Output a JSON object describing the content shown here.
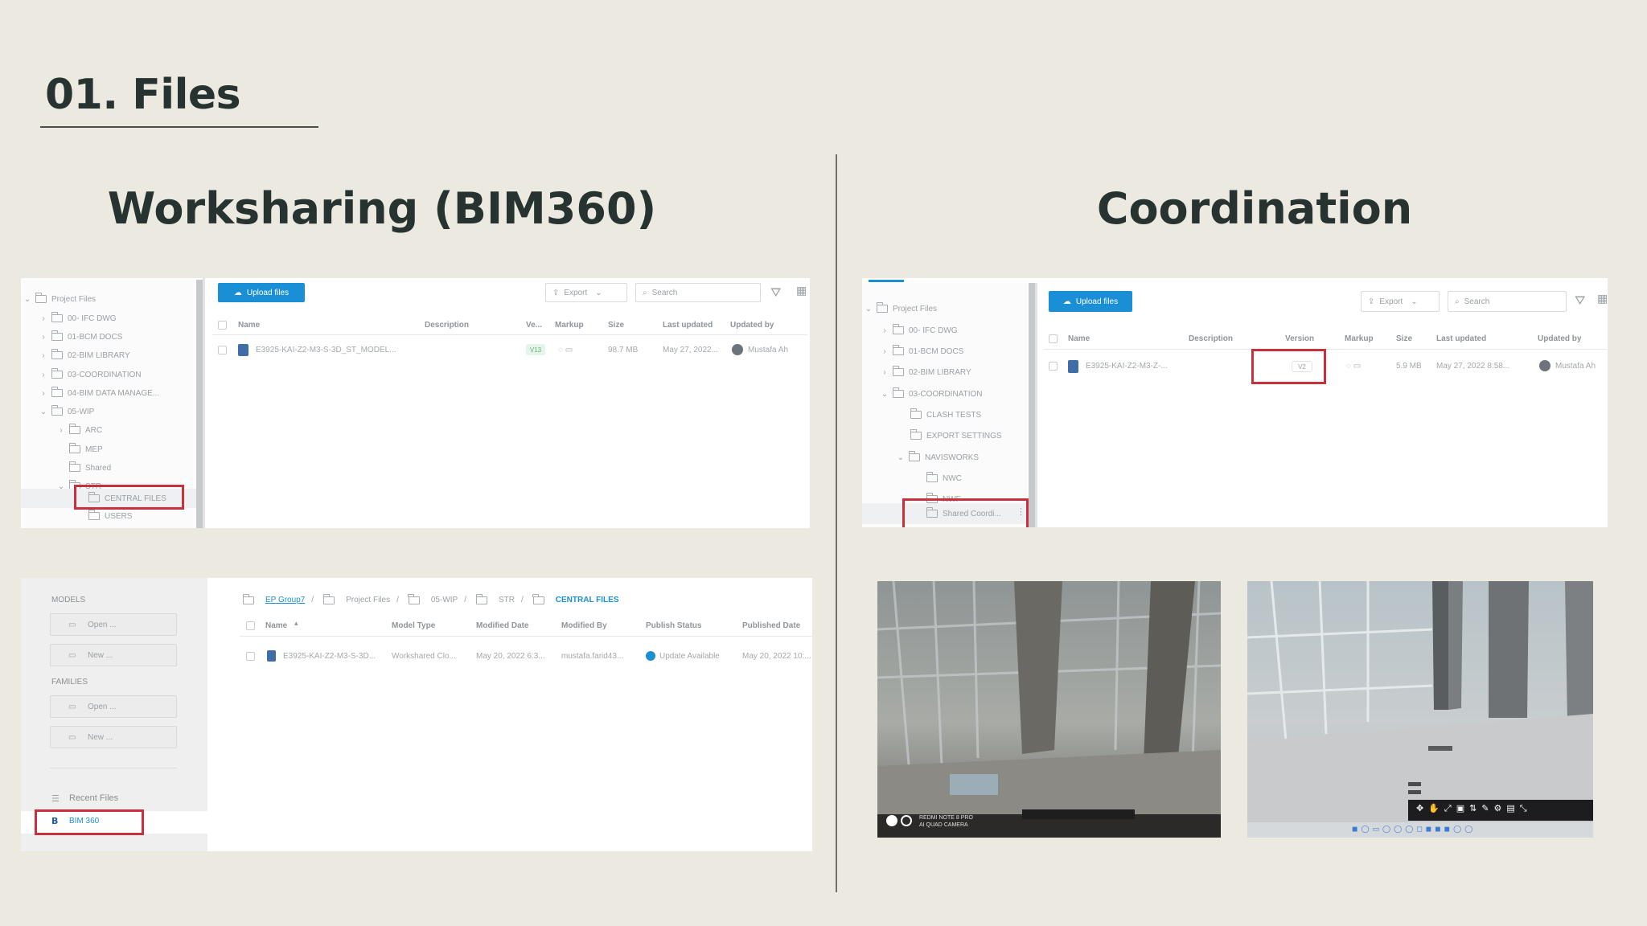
{
  "slide": {
    "title": "01. Files",
    "left_heading": "Worksharing (BIM360)",
    "right_heading": "Coordination"
  },
  "colors": {
    "background": "#ece9e0",
    "heading": "#263330",
    "highlight": "#c9303e",
    "accent_blue": "#1b8fd6"
  },
  "bim360_docs": {
    "upload_label": "Upload files",
    "export_label": "Export",
    "search_placeholder": "Search",
    "tree": {
      "root": "Project Files",
      "items": [
        "00- IFC DWG",
        "01-BCM DOCS",
        "02-BIM LIBRARY",
        "03-COORDINATION",
        "04-BIM DATA MANAGE...",
        "05-WIP",
        "ARC",
        "MEP",
        "Shared",
        "STR",
        "CENTRAL FILES",
        "USERS"
      ]
    },
    "columns": [
      "Name",
      "Description",
      "Ve...",
      "Markup",
      "Size",
      "Last updated",
      "Updated by"
    ],
    "row": {
      "name": "E3925-KAI-Z2-M3-S-3D_ST_MODEL...",
      "version": "V13",
      "size": "98.7 MB",
      "last_updated": "May 27, 2022...",
      "updated_by": "Mustafa Ah"
    }
  },
  "revit_home": {
    "models_label": "MODELS",
    "families_label": "FAMILIES",
    "open_label": "Open ...",
    "new_label": "New ...",
    "recent_files_label": "Recent Files",
    "bim360_label": "BIM 360",
    "breadcrumb": [
      "EP Group7",
      "Project Files",
      "05-WIP",
      "STR",
      "CENTRAL FILES"
    ],
    "columns": [
      "Name",
      "Model Type",
      "Modified Date",
      "Modified By",
      "Publish Status",
      "Published Date"
    ],
    "row": {
      "name": "E3925-KAI-Z2-M3-S-3D...",
      "model_type": "Workshared Clo...",
      "modified_date": "May 20, 2022 6:3...",
      "modified_by": "mustafa.farid43...",
      "publish_status": "Update Available",
      "published_date": "May 20, 2022 10:..."
    }
  },
  "coordination_docs": {
    "upload_label": "Upload files",
    "export_label": "Export",
    "search_placeholder": "Search",
    "tree": {
      "root": "Project Files",
      "items": [
        "00- IFC DWG",
        "01-BCM DOCS",
        "02-BIM LIBRARY",
        "03-COORDINATION",
        "CLASH TESTS",
        "EXPORT SETTINGS",
        "NAVISWORKS",
        "NWC",
        "NWF",
        "Shared Coordi..."
      ]
    },
    "columns": [
      "Name",
      "Description",
      "Version",
      "Markup",
      "Size",
      "Last updated",
      "Updated by"
    ],
    "row": {
      "name": "E3925-KAI-Z2-M3-Z-...",
      "version": "V2",
      "size": "5.9 MB",
      "last_updated": "May 27, 2022 8:58...",
      "updated_by": "Mustafa Ah"
    }
  },
  "renders": {
    "left_caption_line1": "REDMI NOTE 8 PRO",
    "left_caption_line2": "AI QUAD CAMERA"
  }
}
